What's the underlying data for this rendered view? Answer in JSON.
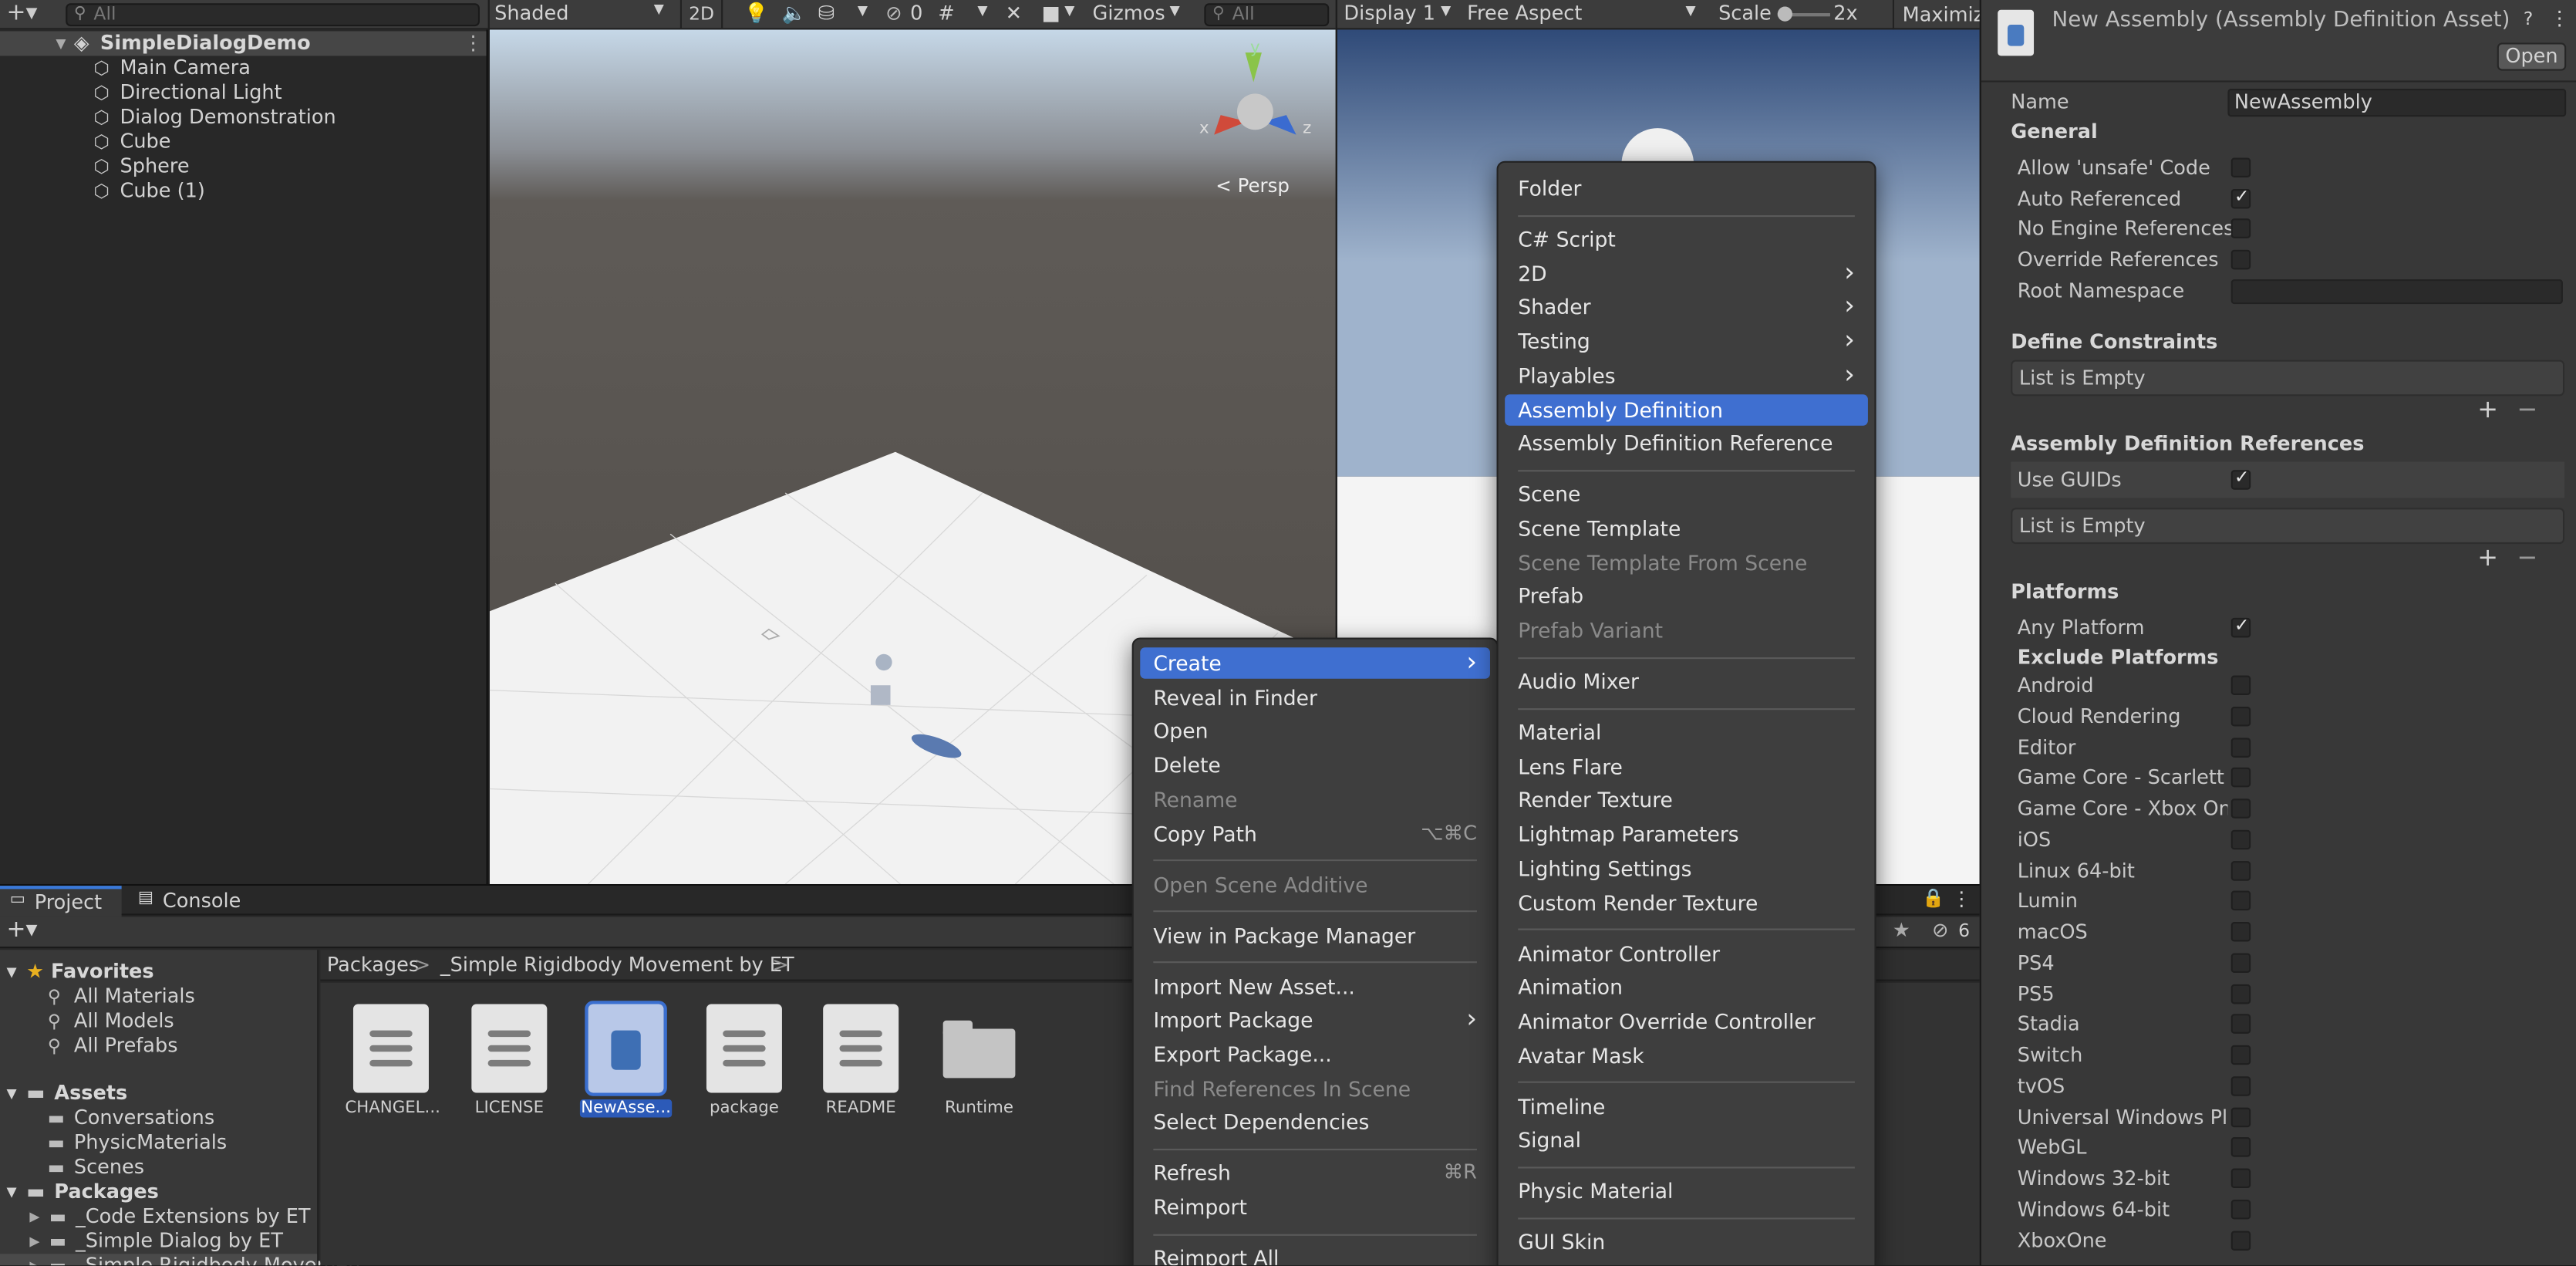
{
  "hierarchy": {
    "search_placeholder": "All",
    "root": "SimpleDialogDemo",
    "items": [
      "Main Camera",
      "Directional Light",
      "Dialog Demonstration",
      "Cube",
      "Sphere",
      "Cube (1)"
    ]
  },
  "scene_toolbar": {
    "shading": "Shaded",
    "mode_2d": "2D",
    "hidden_count": "0",
    "gizmos": "Gizmos",
    "search_placeholder": "All",
    "persp_label": "< Persp",
    "axis_x": "x",
    "axis_y": "y",
    "axis_z": "z"
  },
  "game_toolbar": {
    "display": "Display 1",
    "aspect": "Free Aspect",
    "scale_label": "Scale",
    "scale_value": "2x",
    "maximize": "Maximiz"
  },
  "project": {
    "tabs": [
      "Project",
      "Console"
    ],
    "visible_count": "6",
    "breadcrumb": [
      "Packages",
      "_Simple Rigidbody Movement by ET"
    ],
    "favorites_label": "Favorites",
    "favorites": [
      "All Materials",
      "All Models",
      "All Prefabs"
    ],
    "assets_label": "Assets",
    "assets": [
      "Conversations",
      "PhysicMaterials",
      "Scenes"
    ],
    "packages_label": "Packages",
    "packages": [
      "_Code Extensions by ET",
      "_Simple Dialog by ET",
      "_Simple Rigidbody Movemen"
    ],
    "files": [
      "CHANGEL...",
      "LICENSE",
      "NewAsse...",
      "package",
      "README",
      "Runtime"
    ]
  },
  "inspector": {
    "title": "New Assembly (Assembly Definition Asset) Imp",
    "open_button": "Open",
    "name_label": "Name",
    "name_value": "NewAssembly",
    "general": "General",
    "general_items": [
      {
        "label": "Allow 'unsafe' Code",
        "checked": false
      },
      {
        "label": "Auto Referenced",
        "checked": true
      },
      {
        "label": "No Engine References",
        "checked": false
      },
      {
        "label": "Override References",
        "checked": false
      }
    ],
    "root_namespace": "Root Namespace",
    "define_constraints": "Define Constraints",
    "list_empty": "List is Empty",
    "asm_refs": "Assembly Definition References",
    "use_guids": "Use GUIDs",
    "list_empty_2": "List is Empty",
    "platforms": "Platforms",
    "any_platform": "Any Platform",
    "exclude_platforms": "Exclude Platforms",
    "platform_list": [
      "Android",
      "Cloud Rendering",
      "Editor",
      "Game Core - Scarlett",
      "Game Core - Xbox One",
      "iOS",
      "Linux 64-bit",
      "Lumin",
      "macOS",
      "PS4",
      "PS5",
      "Stadia",
      "Switch",
      "tvOS",
      "Universal Windows Platfo",
      "WebGL",
      "Windows 32-bit",
      "Windows 64-bit",
      "XboxOne"
    ]
  },
  "context_menu": {
    "items": [
      {
        "label": "Create",
        "submenu": true,
        "highlight": true
      },
      {
        "label": "Reveal in Finder"
      },
      {
        "label": "Open"
      },
      {
        "label": "Delete"
      },
      {
        "label": "Rename",
        "disabled": true
      },
      {
        "label": "Copy Path",
        "shortcut": "⌥⌘C"
      },
      {
        "sep": true
      },
      {
        "label": "Open Scene Additive",
        "disabled": true
      },
      {
        "sep": true
      },
      {
        "label": "View in Package Manager"
      },
      {
        "sep": true
      },
      {
        "label": "Import New Asset..."
      },
      {
        "label": "Import Package",
        "submenu": true
      },
      {
        "label": "Export Package..."
      },
      {
        "label": "Find References In Scene",
        "disabled": true
      },
      {
        "label": "Select Dependencies"
      },
      {
        "sep": true
      },
      {
        "label": "Refresh",
        "shortcut": "⌘R"
      },
      {
        "label": "Reimport"
      },
      {
        "sep": true
      },
      {
        "label": "Reimport All"
      }
    ]
  },
  "create_menu": {
    "items": [
      {
        "label": "Folder"
      },
      {
        "sep": true
      },
      {
        "label": "C# Script"
      },
      {
        "label": "2D",
        "submenu": true
      },
      {
        "label": "Shader",
        "submenu": true
      },
      {
        "label": "Testing",
        "submenu": true
      },
      {
        "label": "Playables",
        "submenu": true
      },
      {
        "label": "Assembly Definition",
        "highlight": true
      },
      {
        "label": "Assembly Definition Reference"
      },
      {
        "sep": true
      },
      {
        "label": "Scene"
      },
      {
        "label": "Scene Template"
      },
      {
        "label": "Scene Template From Scene",
        "disabled": true
      },
      {
        "label": "Prefab"
      },
      {
        "label": "Prefab Variant",
        "disabled": true
      },
      {
        "sep": true
      },
      {
        "label": "Audio Mixer"
      },
      {
        "sep": true
      },
      {
        "label": "Material"
      },
      {
        "label": "Lens Flare"
      },
      {
        "label": "Render Texture"
      },
      {
        "label": "Lightmap Parameters"
      },
      {
        "label": "Lighting Settings"
      },
      {
        "label": "Custom Render Texture"
      },
      {
        "sep": true
      },
      {
        "label": "Animator Controller"
      },
      {
        "label": "Animation"
      },
      {
        "label": "Animator Override Controller"
      },
      {
        "label": "Avatar Mask"
      },
      {
        "sep": true
      },
      {
        "label": "Timeline"
      },
      {
        "label": "Signal"
      },
      {
        "sep": true
      },
      {
        "label": "Physic Material"
      },
      {
        "sep": true
      },
      {
        "label": "GUI Skin"
      }
    ]
  }
}
